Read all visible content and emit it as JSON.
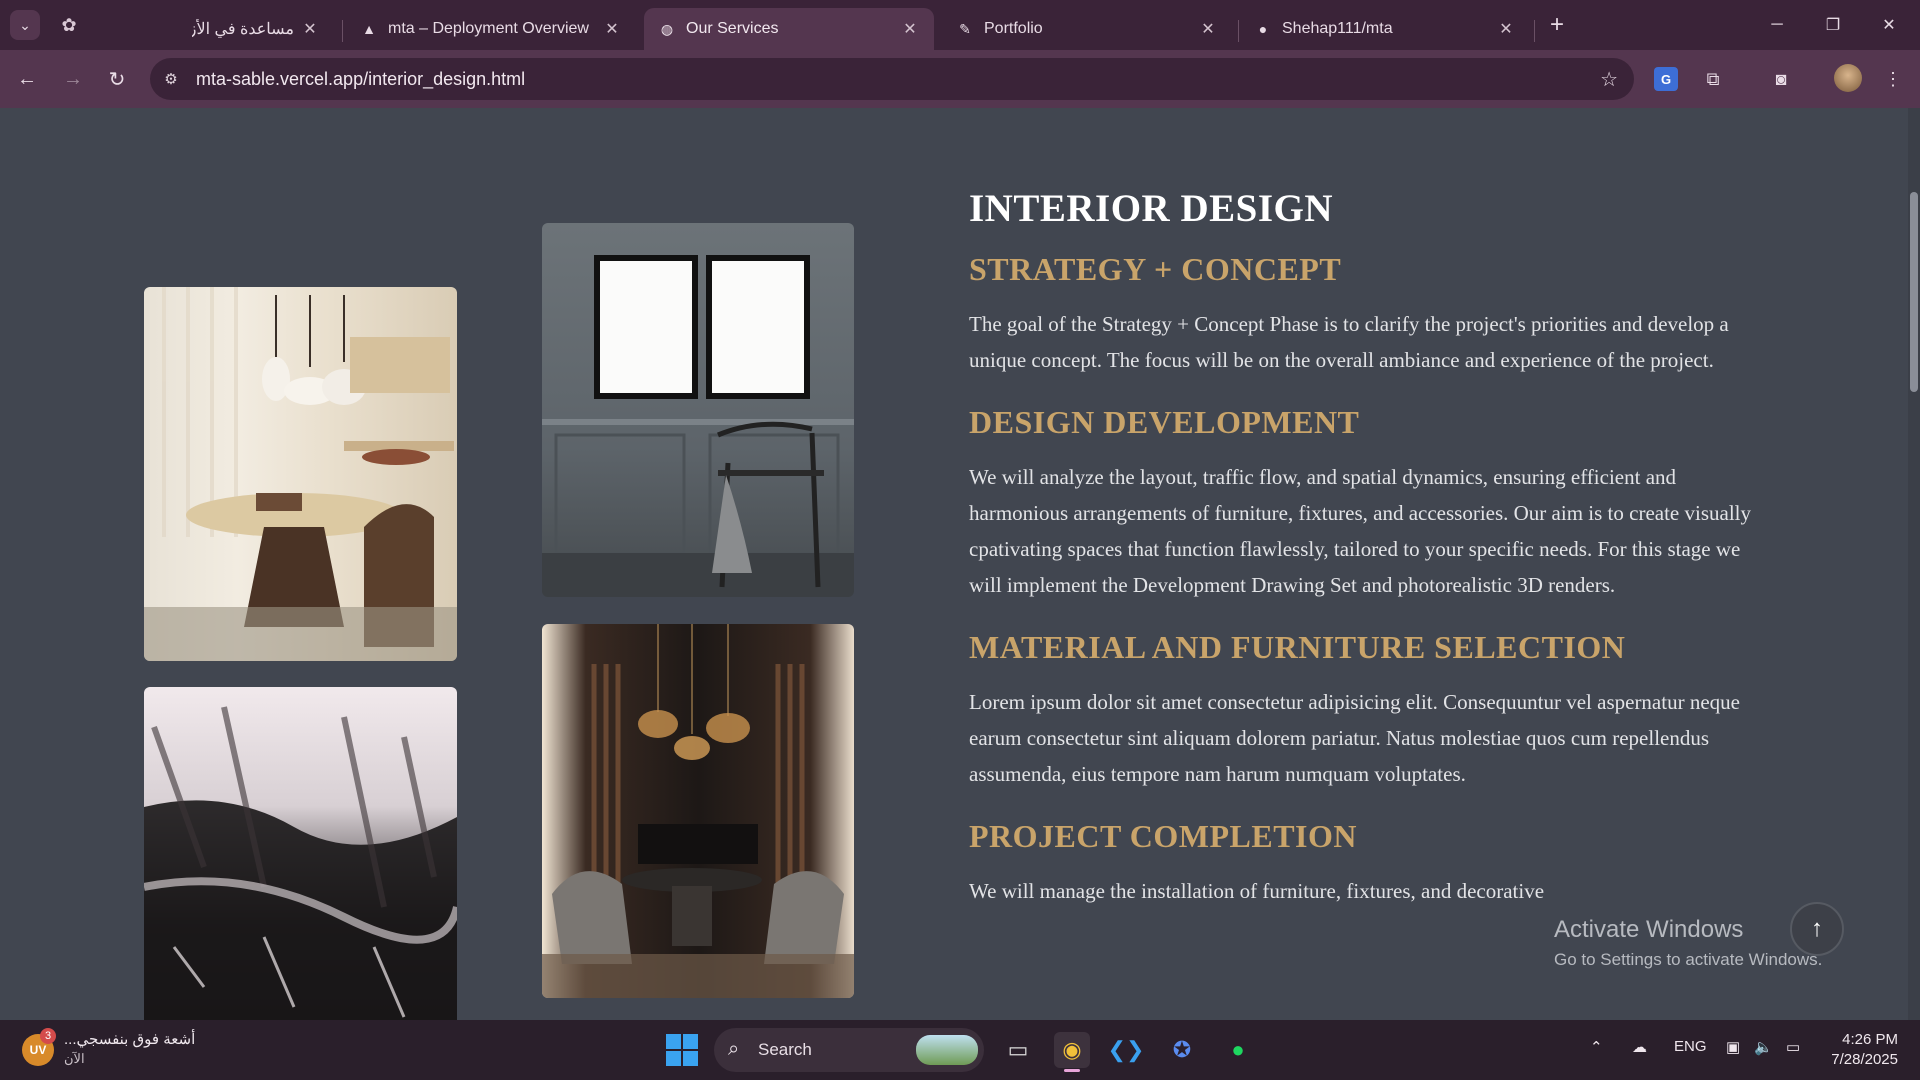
{
  "browser": {
    "tabs": [
      {
        "title": "مساعدة في الأزمة",
        "active": false
      },
      {
        "title": "mta – Deployment Overview",
        "active": false
      },
      {
        "title": "Our Services",
        "active": true
      },
      {
        "title": "Portfolio",
        "active": false
      },
      {
        "title": "Shehap111/mta",
        "active": false
      }
    ],
    "url": "mta-sable.vercel.app/interior_design.html"
  },
  "page": {
    "title": "INTERIOR DESIGN",
    "sections": [
      {
        "heading": "STRATEGY + CONCEPT",
        "body": "The goal of the Strategy + Concept Phase is to clarify the project's priorities and develop a unique concept. The focus will be on the overall ambiance and experience of the project."
      },
      {
        "heading": "DESIGN DEVELOPMENT",
        "body": "We will analyze the layout, traffic flow, and spatial dynamics, ensuring efficient and harmonious arrangements of furniture, fixtures, and accessories. Our aim is to create visually cpativating spaces that function flawlessly, tailored to your specific needs. For this stage we will implement the Development Drawing Set and photorealistic 3D renders."
      },
      {
        "heading": "MATERIAL AND FURNITURE SELECTION",
        "body": "Lorem ipsum dolor sit amet consectetur adipisicing elit. Consequuntur vel aspernatur neque earum consectetur sint aliquam dolorem pariatur. Natus molestiae quos cum repellendus assumenda, eius tempore nam harum numquam voluptates."
      },
      {
        "heading": "PROJECT COMPLETION",
        "body": "We will manage the installation of furniture, fixtures, and decorative"
      }
    ]
  },
  "watermark": {
    "line1": "Activate Windows",
    "line2": "Go to Settings to activate Windows."
  },
  "taskbar": {
    "notification_badge": "3",
    "notification_avatar": "UV",
    "news_title": "أشعة فوق بنفسجي...",
    "news_time": "الآن",
    "search_label": "Search",
    "language": "ENG",
    "time": "4:26 PM",
    "date": "7/28/2025"
  }
}
